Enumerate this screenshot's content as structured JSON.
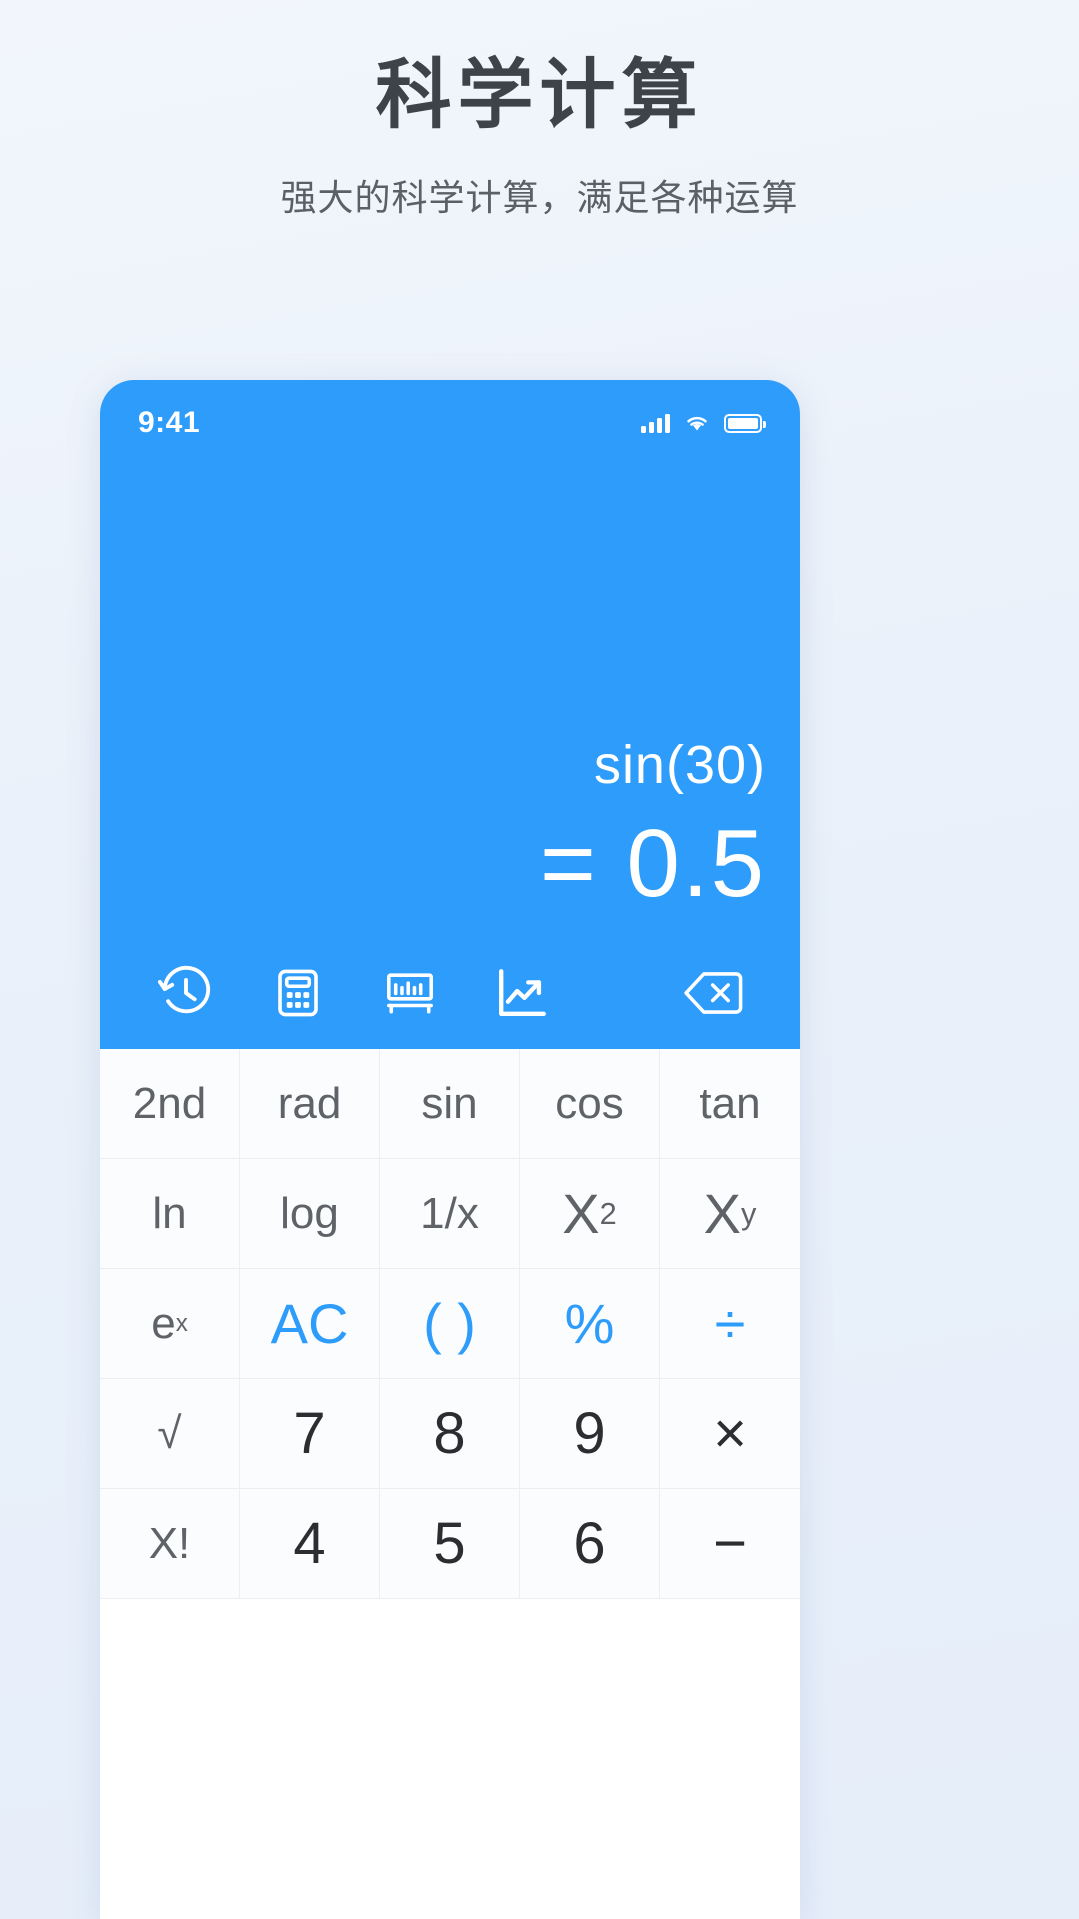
{
  "promo": {
    "title": "科学计算",
    "subtitle": "强大的科学计算，满足各种运算"
  },
  "colors": {
    "accent": "#2d9cfb",
    "page_bg": "#eef3fb",
    "key_bg": "#fbfcfd",
    "key_text": "#5f6368",
    "digit_text": "#2b2d30"
  },
  "phone": {
    "statusbar": {
      "time": "9:41",
      "icons": [
        "signal-icon",
        "wifi-icon",
        "battery-icon"
      ]
    },
    "display": {
      "expression": "sin(30)",
      "result": "= 0.5"
    },
    "toolbar": [
      {
        "name": "history-icon",
        "label": "history"
      },
      {
        "name": "calculator-icon",
        "label": "calculator"
      },
      {
        "name": "ruler-icon",
        "label": "unit-converter"
      },
      {
        "name": "chart-icon",
        "label": "chart"
      },
      {
        "name": "backspace-icon",
        "label": "backspace"
      }
    ],
    "keypad": {
      "rows": [
        [
          {
            "label": "2nd",
            "style": "fn"
          },
          {
            "label": "rad",
            "style": "fn"
          },
          {
            "label": "sin",
            "style": "fn"
          },
          {
            "label": "cos",
            "style": "fn"
          },
          {
            "label": "tan",
            "style": "fn"
          }
        ],
        [
          {
            "label": "ln",
            "style": "fn"
          },
          {
            "label": "log",
            "style": "fn"
          },
          {
            "label": "1/x",
            "style": "fn"
          },
          {
            "label": "X²",
            "style": "fn",
            "base": "X",
            "sup": "2"
          },
          {
            "label": "Xʸ",
            "style": "fn",
            "base": "X",
            "sup": "y"
          }
        ],
        [
          {
            "label": "eˣ",
            "style": "fn",
            "base": "e",
            "sup": "x"
          },
          {
            "label": "AC",
            "style": "blue"
          },
          {
            "label": "( )",
            "style": "blue"
          },
          {
            "label": "%",
            "style": "blue"
          },
          {
            "label": "÷",
            "style": "blue"
          }
        ],
        [
          {
            "label": "√",
            "style": "fn"
          },
          {
            "label": "7",
            "style": "digit"
          },
          {
            "label": "8",
            "style": "digit"
          },
          {
            "label": "9",
            "style": "digit"
          },
          {
            "label": "×",
            "style": "blue"
          }
        ],
        [
          {
            "label": "X!",
            "style": "fn"
          },
          {
            "label": "4",
            "style": "digit"
          },
          {
            "label": "5",
            "style": "digit"
          },
          {
            "label": "6",
            "style": "digit"
          },
          {
            "label": "−",
            "style": "blue"
          }
        ]
      ]
    }
  }
}
